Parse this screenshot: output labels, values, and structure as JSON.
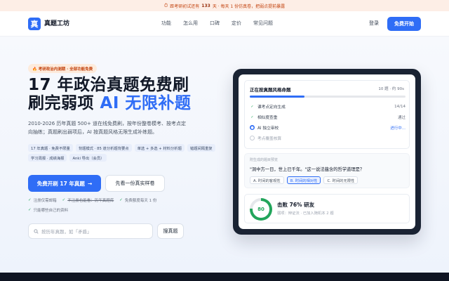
{
  "banner": {
    "icon": "⏱",
    "prefix": "距考研初试还有",
    "days": "133",
    "suffix": "天 · 每天 1 份仿真卷，把弱点提前暴露"
  },
  "nav": {
    "logo_char": "真",
    "logo_text": "真题工坊",
    "links": [
      "功能",
      "怎么用",
      "口碑",
      "定价",
      "常见问题"
    ],
    "login": "登录",
    "start": "免费开始"
  },
  "hero": {
    "tag": "🔥 考研政治内测期 · 全部功能免费",
    "title_line1": "17 年政治真题免费刷",
    "title_line2_a": "刷完弱项 ",
    "title_line2_b": "AI 无限补题",
    "desc": "2010-2026 历年真题 500+ 道在线免费刷，按年份整卷模考、按考点定向抽练；真题刷出弱项后，AI 按真题风格无限生成补练题。",
    "pills": [
      "17 年真题 · 免费不限量",
      "背题模式 · 85 道分析题背要点",
      "单选 + 多选 + 材料分析题",
      "错题间隔重复",
      "学习周报 · 成绩海报",
      "Anki 导出（会员）"
    ],
    "primary_btn": "免费开刷 17 年真题",
    "primary_arrow": "→",
    "secondary_btn": "先看一份真实样卷",
    "checks": [
      "注册仅需邮箱",
      "不注册也能看：历年真题库",
      "免费额度每天 1 份",
      "只能哪些自己的资料"
    ],
    "search_placeholder": "按历年真题，如「矛盾」",
    "search_btn": "搜真题"
  },
  "panel": {
    "title": "正在按真题风格命题",
    "meta": "10 题 · 约 90s",
    "progress_fraction": 0.35,
    "steps": [
      {
        "label": "课考点定向生成",
        "right": "14/14",
        "state": "done"
      },
      {
        "label": "相似度查重",
        "right": "通过",
        "state": "done"
      },
      {
        "label": "AI 独立审校",
        "right": "进行中...",
        "state": "active"
      },
      {
        "label": "考点覆盖核算",
        "right": "",
        "state": "pending"
      }
    ],
    "q_caption": "附生成的题目预览",
    "question": "\"洞中方一日，世上已千年。\"这一说法蕴含的哲学道理是？",
    "options": [
      "A. 时间的客观性",
      "B. 时间的相对性",
      "C. 时间的无限性"
    ],
    "selected_option": 1,
    "score": "80",
    "score_fraction": 0.76,
    "result_title": "击败 76% 研友",
    "result_sub": "弱项：辩证法 · 已加入随机本 2 题"
  },
  "colors": {
    "accent": "#2f6df6",
    "success": "#22a55b",
    "warn": "#c2410c"
  }
}
